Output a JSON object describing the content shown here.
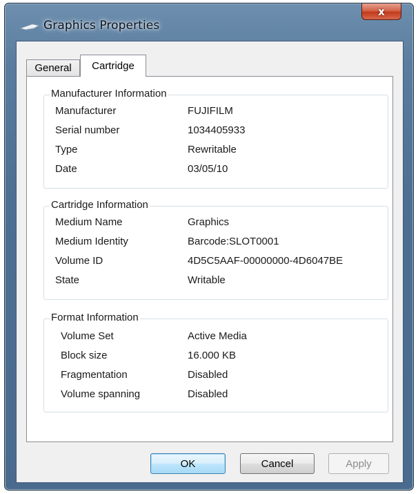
{
  "window": {
    "title": "Graphics Properties",
    "close_glyph": "x",
    "title_icon": "graphics-icon"
  },
  "tabs": [
    {
      "label": "General",
      "selected": false
    },
    {
      "label": "Cartridge",
      "selected": true
    }
  ],
  "groups": {
    "manufacturer": {
      "title": "Manufacturer Information",
      "rows": [
        {
          "label": "Manufacturer",
          "value": "FUJIFILM"
        },
        {
          "label": "Serial number",
          "value": "1034405933"
        },
        {
          "label": "Type",
          "value": "Rewritable"
        },
        {
          "label": "Date",
          "value": "03/05/10"
        }
      ]
    },
    "cartridge": {
      "title": "Cartridge Information",
      "rows": [
        {
          "label": "Medium Name",
          "value": "Graphics"
        },
        {
          "label": "Medium Identity",
          "value": "Barcode:SLOT0001"
        },
        {
          "label": "Volume ID",
          "value": "4D5C5AAF-00000000-4D6047BE"
        },
        {
          "label": "State",
          "value": "Writable"
        }
      ]
    },
    "format": {
      "title": "Format Information",
      "rows": [
        {
          "label": "Volume Set",
          "value": "Active Media"
        },
        {
          "label": "Block size",
          "value": "16.000 KB"
        },
        {
          "label": "Fragmentation",
          "value": "Disabled"
        },
        {
          "label": "Volume spanning",
          "value": "Disabled"
        }
      ]
    }
  },
  "buttons": {
    "ok": "OK",
    "cancel": "Cancel",
    "apply": "Apply",
    "apply_enabled": false
  },
  "colors": {
    "titlebar": "#4d6f92",
    "close_button": "#c33a1d",
    "ok_border": "#3c7fb1"
  }
}
